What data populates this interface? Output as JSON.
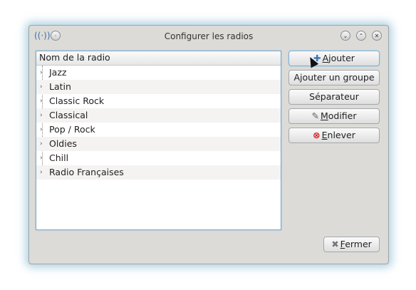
{
  "window": {
    "title": "Configurer les radios",
    "app_icon": "radio-antenna-icon",
    "title_buttons": [
      "menu-icon",
      "minimize-icon",
      "maximize-icon",
      "close-icon"
    ],
    "accent_color": "#6eaac8"
  },
  "list": {
    "header": "Nom de la radio",
    "items": [
      {
        "label": "Jazz"
      },
      {
        "label": "Latin"
      },
      {
        "label": "Classic Rock"
      },
      {
        "label": "Classical"
      },
      {
        "label": "Pop / Rock"
      },
      {
        "label": "Oldies"
      },
      {
        "label": "Chill"
      },
      {
        "label": "Radio Françaises"
      }
    ]
  },
  "buttons": {
    "add": {
      "label_prefix": "A",
      "label_rest": "jouter",
      "icon": "plus-icon"
    },
    "add_group": {
      "label": "Ajouter un groupe"
    },
    "separator": {
      "label": "Séparateur"
    },
    "modify": {
      "label_prefix": "M",
      "label_rest": "odifier",
      "icon": "edit-document-icon"
    },
    "remove": {
      "label_prefix": "E",
      "label_rest": "nlever",
      "icon": "remove-circle-icon"
    },
    "close": {
      "label_prefix": "F",
      "label_rest": "ermer",
      "icon": "close-x-icon"
    }
  }
}
